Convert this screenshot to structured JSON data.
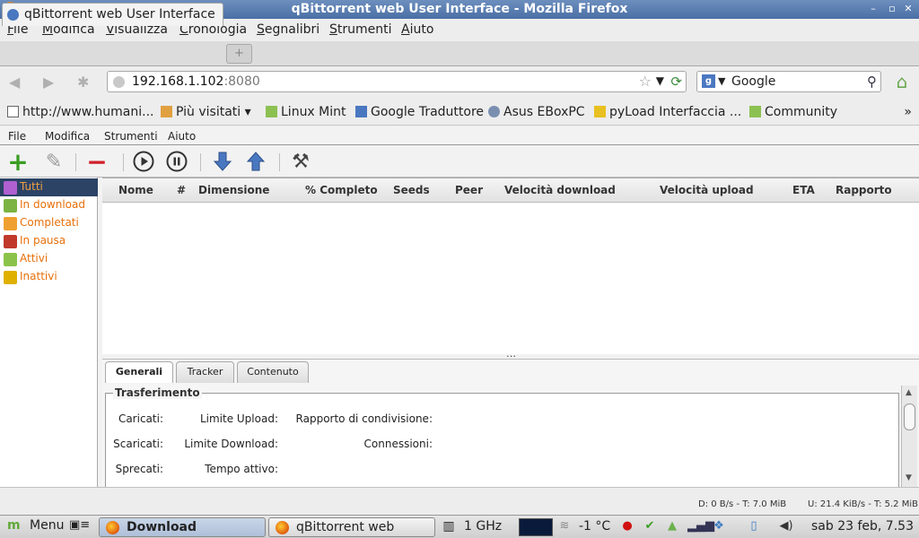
{
  "window": {
    "title": "qBittorrent web User Interface - Mozilla Firefox"
  },
  "menubar": [
    {
      "label": "File",
      "accel": "F"
    },
    {
      "label": "Modifica",
      "accel": "M"
    },
    {
      "label": "Visualizza",
      "accel": "V"
    },
    {
      "label": "Cronologia",
      "accel": "C"
    },
    {
      "label": "Segnalibri",
      "accel": "S"
    },
    {
      "label": "Strumenti",
      "accel": "S"
    },
    {
      "label": "Aiuto",
      "accel": "A"
    }
  ],
  "tab": {
    "label": "qBittorrent web User Interface",
    "new_tab": "+"
  },
  "url": {
    "host": "192.168.1.102",
    "port": ":8080"
  },
  "search": {
    "engine": "Google"
  },
  "bookmarks": [
    {
      "label": "http://www.humani...",
      "icon": "page-icon"
    },
    {
      "label": "Più visitati ▾",
      "icon": "folder-icon"
    },
    {
      "label": "Linux Mint",
      "icon": "mint-icon"
    },
    {
      "label": "Google Traduttore",
      "icon": "translate-icon"
    },
    {
      "label": "Asus EBoxPC",
      "icon": "gear-icon"
    },
    {
      "label": "pyLoad Interfaccia ...",
      "icon": "python-icon"
    },
    {
      "label": "Community",
      "icon": "mint-icon"
    }
  ],
  "bookmarks_more": "»",
  "webui": {
    "menu": [
      "File",
      "Modifica",
      "Strumenti",
      "Aiuto"
    ],
    "toolbar": [
      "add-torrent-icon",
      "add-link-icon",
      "delete-icon",
      "resume-icon",
      "pause-icon",
      "priority-down-icon",
      "priority-up-icon",
      "options-icon"
    ],
    "filters": [
      {
        "label": "Tutti",
        "color": "#b060d0",
        "selected": true
      },
      {
        "label": "In download",
        "color": "#7cb342",
        "selected": false
      },
      {
        "label": "Completati",
        "color": "#f0a030",
        "selected": false
      },
      {
        "label": "In pausa",
        "color": "#c0392b",
        "selected": false
      },
      {
        "label": "Attivi",
        "color": "#8bc34a",
        "selected": false
      },
      {
        "label": "Inattivi",
        "color": "#e0b000",
        "selected": false
      }
    ],
    "columns": [
      "Nome",
      "#",
      "Dimensione",
      "% Completo",
      "Seeds",
      "Peer",
      "Velocità download",
      "Velocità upload",
      "ETA",
      "Rapporto"
    ],
    "panel_tabs": [
      "Generali",
      "Tracker",
      "Contenuto"
    ],
    "transfer": {
      "legend": "Trasferimento",
      "labels": [
        "Caricati:",
        "Limite Upload:",
        "Rapporto di condivisione:",
        "Scaricati:",
        "Limite Download:",
        "Connessioni:",
        "Sprecati:",
        "Tempo attivo:"
      ]
    },
    "status": {
      "download": "D: 0 B/s - T: 7.0 MiB",
      "upload": "U: 21.4 KiB/s - T: 5.2 MiB"
    }
  },
  "taskbar": {
    "menu": "Menu",
    "windows": [
      {
        "label": "Download",
        "active": true
      },
      {
        "label": "qBittorrent web User...",
        "active": false
      }
    ],
    "cpu": "1 GHz",
    "weather": "-1 °C",
    "clock": "sab 23 feb, 7.53"
  }
}
